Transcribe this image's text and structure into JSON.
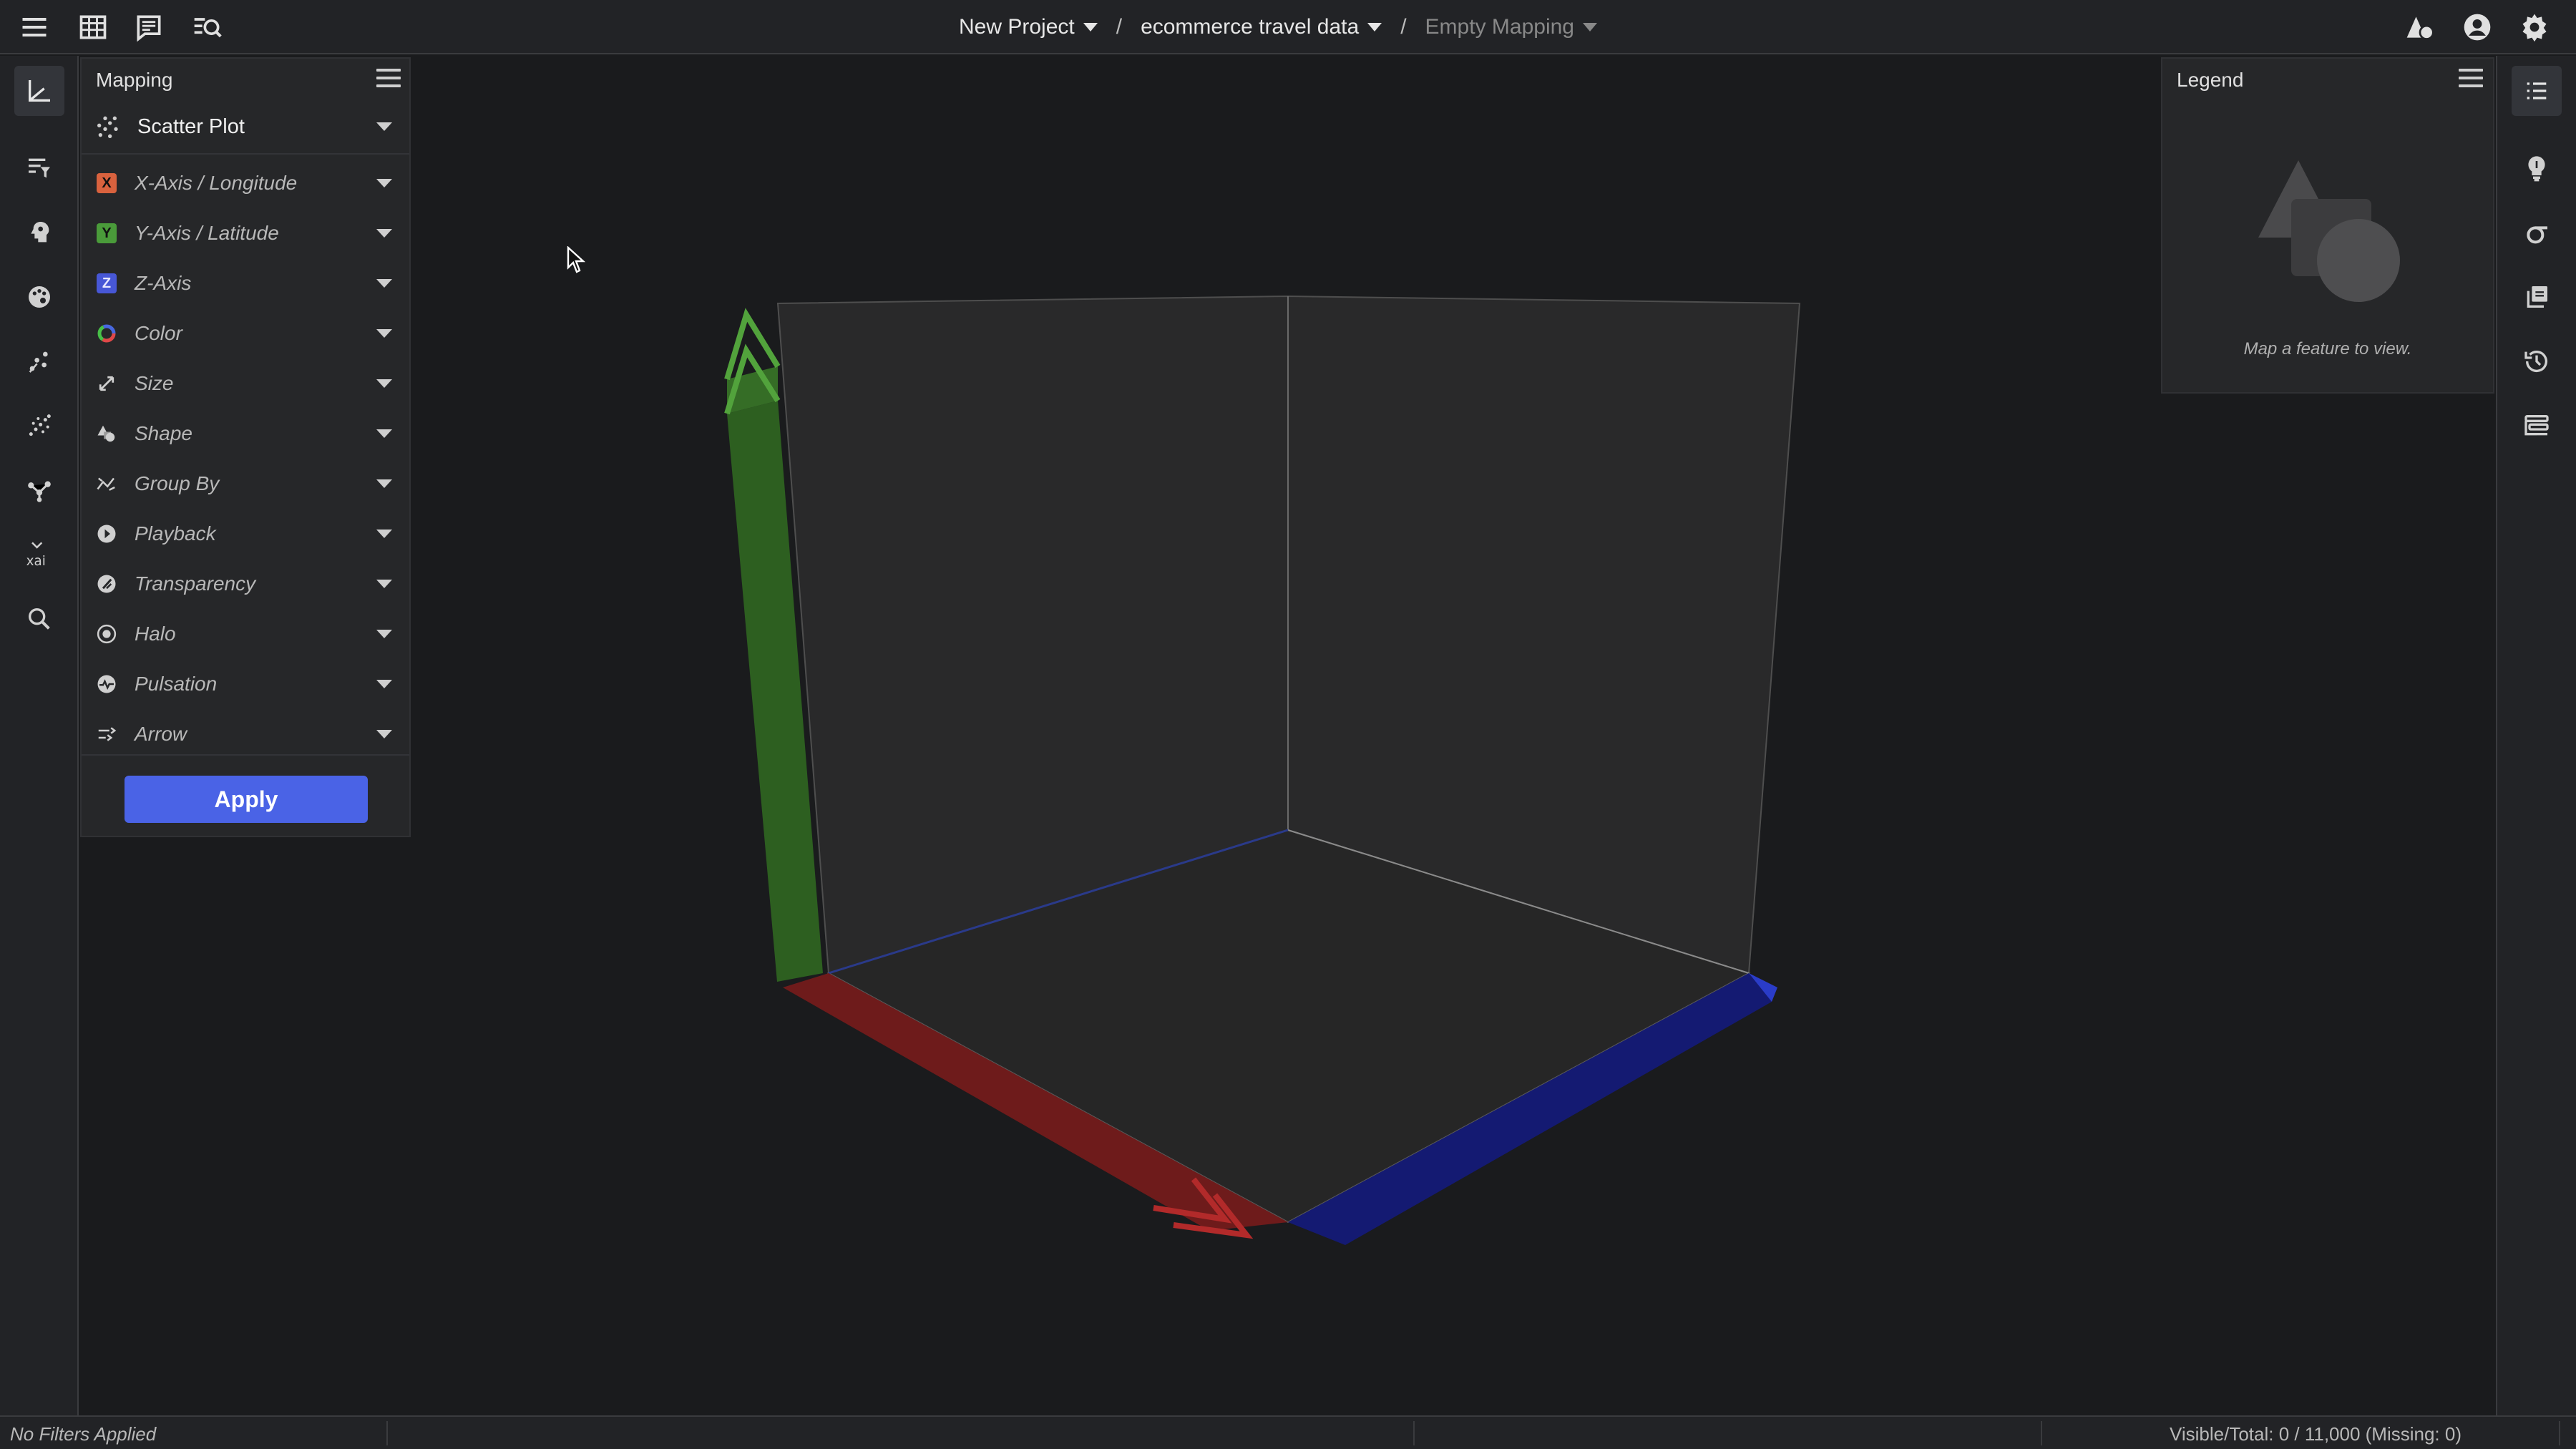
{
  "header": {
    "project": "New Project",
    "dataset": "ecommerce travel data",
    "mapping": "Empty Mapping",
    "separator": "/"
  },
  "left_rail": {
    "icons": [
      "axes-icon",
      "filter-icon",
      "brain-icon",
      "palette-icon",
      "scatter-icon",
      "cluster-icon",
      "network-icon",
      "xai-icon",
      "search-icon"
    ]
  },
  "mapping_panel": {
    "title": "Mapping",
    "plot_type": "Scatter Plot",
    "rows": [
      {
        "label": "X-Axis / Longitude",
        "badge": "X",
        "color": "#d9623e"
      },
      {
        "label": "Y-Axis / Latitude",
        "badge": "Y",
        "color": "#4a9b3a"
      },
      {
        "label": "Z-Axis",
        "badge": "Z",
        "color": "#4757d6"
      },
      {
        "label": "Color"
      },
      {
        "label": "Size"
      },
      {
        "label": "Shape"
      },
      {
        "label": "Group By"
      },
      {
        "label": "Playback"
      },
      {
        "label": "Transparency"
      },
      {
        "label": "Halo"
      },
      {
        "label": "Pulsation"
      },
      {
        "label": "Arrow"
      }
    ],
    "apply_label": "Apply"
  },
  "legend": {
    "title": "Legend",
    "empty_message": "Map a feature to view."
  },
  "right_rail": {
    "icons": [
      "list-icon",
      "lightbulb-icon",
      "sigma-icon",
      "copy-icon",
      "history-icon",
      "layers-icon"
    ]
  },
  "status": {
    "filters": "No Filters Applied",
    "counts": "Visible/Total: 0 / 11,000 (Missing: 0)"
  },
  "colors": {
    "x_axis": "#8a1f1f",
    "y_axis": "#2f6a22",
    "z_axis": "#1c2488",
    "accent": "#4a63e6"
  }
}
